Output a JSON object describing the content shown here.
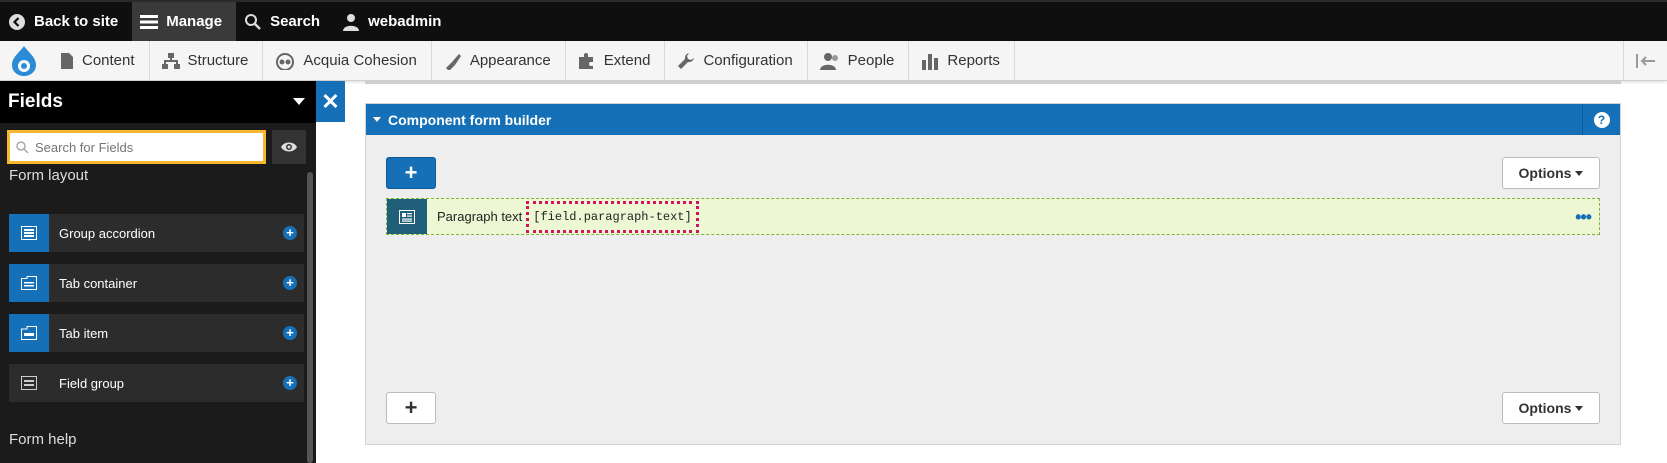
{
  "topbar": {
    "back_label": "Back to site",
    "manage_label": "Manage",
    "search_label": "Search",
    "user_label": "webadmin"
  },
  "tray": {
    "items": [
      {
        "label": "Content",
        "icon": "document-icon"
      },
      {
        "label": "Structure",
        "icon": "structure-icon"
      },
      {
        "label": "Acquia Cohesion",
        "icon": "cohesion-icon"
      },
      {
        "label": "Appearance",
        "icon": "brush-icon"
      },
      {
        "label": "Extend",
        "icon": "puzzle-icon"
      },
      {
        "label": "Configuration",
        "icon": "wrench-icon"
      },
      {
        "label": "People",
        "icon": "people-icon"
      },
      {
        "label": "Reports",
        "icon": "bar-chart-icon"
      }
    ]
  },
  "sidebar": {
    "title": "Fields",
    "search_placeholder": "Search for Fields",
    "form_layout_label": "Form layout",
    "form_help_label": "Form help",
    "items": [
      {
        "label": "Group accordion"
      },
      {
        "label": "Tab container"
      },
      {
        "label": "Tab item"
      },
      {
        "label": "Field group"
      }
    ]
  },
  "panel": {
    "title": "Component form builder",
    "options_label": "Options",
    "field": {
      "label": "Paragraph text",
      "token": "[field.paragraph-text]"
    }
  },
  "colors": {
    "primary_blue": "#1570b7",
    "focus_orange": "#f6b62e",
    "field_bg": "#eef7d4",
    "token_outline": "#d0155e"
  }
}
